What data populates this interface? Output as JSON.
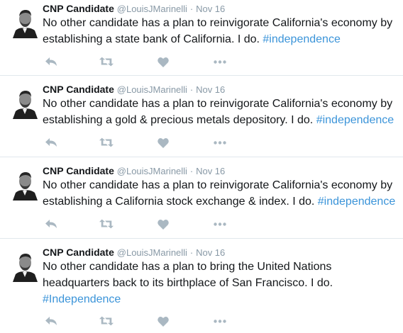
{
  "tweets": [
    {
      "name": "CNP Candidate",
      "handle": "@LouisJMarinelli",
      "separator": "·",
      "date": "Nov 16",
      "text": "No other candidate has a plan to reinvigorate California's economy by establishing a state bank of California. I do. ",
      "hashtag": "#independence"
    },
    {
      "name": "CNP Candidate",
      "handle": "@LouisJMarinelli",
      "separator": "·",
      "date": "Nov 16",
      "text": "No other candidate has a plan to reinvigorate California's economy by establishing a gold & precious metals depository. I do. ",
      "hashtag": "#independence"
    },
    {
      "name": "CNP Candidate",
      "handle": "@LouisJMarinelli",
      "separator": "·",
      "date": "Nov 16",
      "text": "No other candidate has a plan to reinvigorate California's economy by establishing a California stock exchange & index. I do. ",
      "hashtag": "#independence"
    },
    {
      "name": "CNP Candidate",
      "handle": "@LouisJMarinelli",
      "separator": "·",
      "date": "Nov 16",
      "text": "No other candidate has a plan to bring the United Nations headquarters back to its birthplace of San Francisco. I do. ",
      "hashtag": "#Independence"
    }
  ],
  "icons": {
    "reply": "reply-icon",
    "retweet": "retweet-icon",
    "like": "heart-icon",
    "more": "more-dots-icon"
  },
  "colors": {
    "name": "#14171a",
    "meta": "#8899a6",
    "hashtag": "#3b94d9",
    "icon": "#aab8c2",
    "divider": "#e1e8ed"
  }
}
